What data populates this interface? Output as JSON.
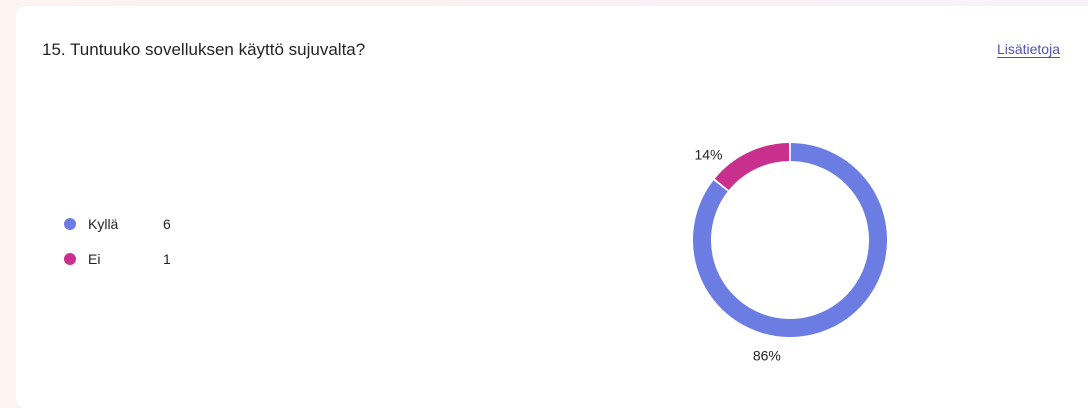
{
  "question": {
    "title": "15. Tuntuuko sovelluksen käyttö sujuvalta?",
    "more_link": "Lisätietoja"
  },
  "legend": [
    {
      "label": "Kyllä",
      "count": "6",
      "color": "#6b7de3"
    },
    {
      "label": "Ei",
      "count": "1",
      "color": "#c92f8c"
    }
  ],
  "chart_data": {
    "type": "pie",
    "style": "donut",
    "categories": [
      "Kyllä",
      "Ei"
    ],
    "values": [
      6,
      1
    ],
    "percent_labels": [
      "86%",
      "14%"
    ],
    "colors": [
      "#6b7de3",
      "#c92f8c"
    ]
  }
}
